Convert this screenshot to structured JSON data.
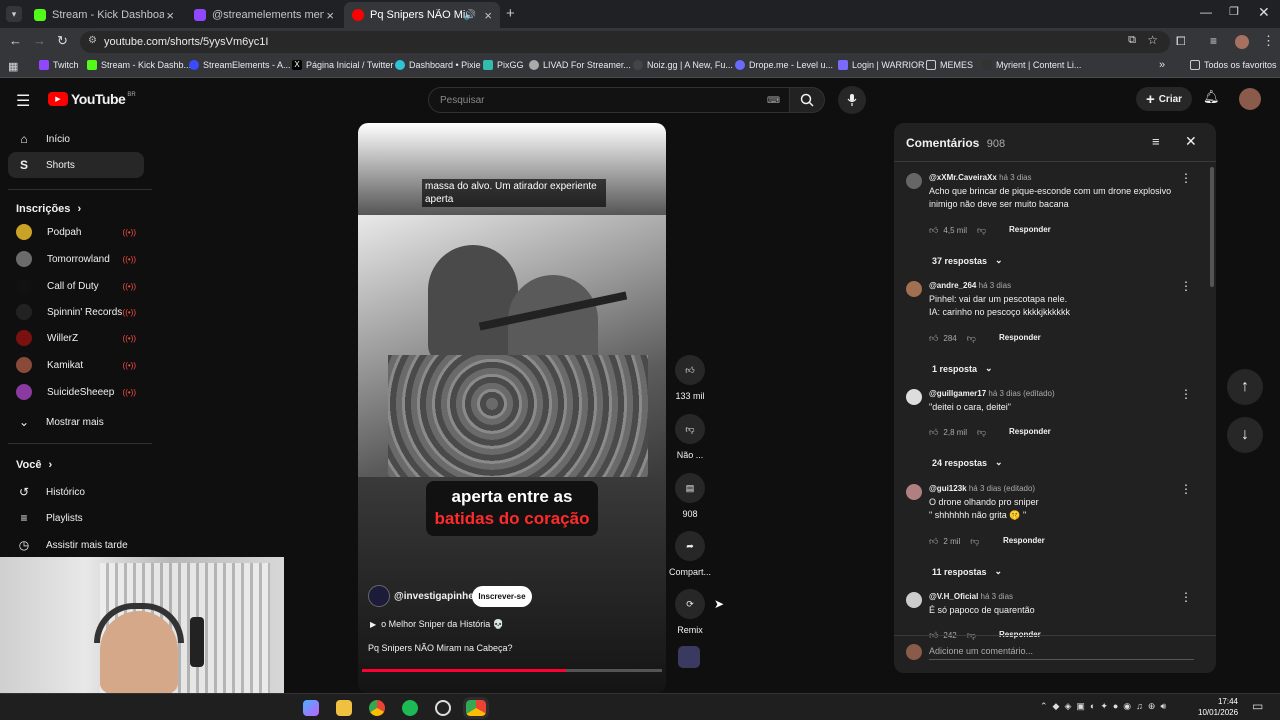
{
  "browser": {
    "tabs": [
      {
        "title": "Stream - Kick Dashboard",
        "color": "#53fc18"
      },
      {
        "title": "@streamelements mentione",
        "color": "#9146ff"
      },
      {
        "title": "Pq Snipers NÃO Miram na C",
        "color": "#ff0000"
      }
    ],
    "url": "youtube.com/shorts/5yysVm6yc1I",
    "bookmarks": [
      "Twitch",
      "Stream - Kick Dashb...",
      "StreamElements - A...",
      "Página Inicial / Twitter",
      "Dashboard • Pixie",
      "PixGG",
      "LIVAD For Streamer...",
      "Noiz.gg | A New, Fu...",
      "Drope.me - Level u...",
      "Login | WARRIOR",
      "MEMES",
      "Myrient | Content Li..."
    ],
    "all_bookmarks": "Todos os favoritos"
  },
  "youtube": {
    "logo_text": "YouTube",
    "country": "BR",
    "search_placeholder": "Pesquisar",
    "create_label": "Criar",
    "sidebar": {
      "home": "Início",
      "shorts": "Shorts",
      "subscriptions_heading": "Inscrições",
      "subscriptions": [
        {
          "name": "Podpah",
          "color": "#c9a227"
        },
        {
          "name": "Tomorrowland",
          "color": "#6b6b6b"
        },
        {
          "name": "Call of Duty",
          "color": "#111111"
        },
        {
          "name": "Spinnin' Records",
          "color": "#222222"
        },
        {
          "name": "WillerZ",
          "color": "#7a1010"
        },
        {
          "name": "Kamikat",
          "color": "#8a4a3a"
        },
        {
          "name": "SuicideSheeep",
          "color": "#8a3aa0"
        }
      ],
      "show_more": "Mostrar mais",
      "you_heading": "Você",
      "history": "Histórico",
      "playlists": "Playlists",
      "watch_later": "Assistir mais tarde"
    },
    "video": {
      "caption": "massa do alvo. Um atirador experiente aperta",
      "overlay_line1": "aperta entre as",
      "overlay_line2": "batidas do coração",
      "channel": "@investigapinhel",
      "subscribe": "Inscrever-se",
      "playlist": "o Melhor Sniper da História 💀",
      "title": "Pq Snipers NÃO Miram na Cabeça?",
      "progress": 0.68
    },
    "actions": {
      "likes": "133 mil",
      "dislike": "Não ...",
      "comments": "908",
      "share": "Compart...",
      "remix": "Remix"
    },
    "comments_panel": {
      "title": "Comentários",
      "count": "908",
      "add_placeholder": "Adicione um comentário...",
      "items": [
        {
          "author": "@xXMr.CaveiraXx",
          "time": "há 3 dias",
          "text": "Acho que brincar de pique-esconde com um drone explosivo inimigo não deve ser muito bacana",
          "likes": "4,5 mil",
          "replies": "37 respostas",
          "avatar": "#666"
        },
        {
          "author": "@andre_264",
          "time": "há 3 dias",
          "text": "Pinhel: vai dar um pescotapa nele.\nIA: carinho no pescoço kkkkjkkkkkk",
          "likes": "284",
          "replies": "1 resposta",
          "avatar": "#a07050"
        },
        {
          "author": "@guillgamer17",
          "time": "há 3 dias (editado)",
          "text": "\"deitei o cara, deitei\"",
          "likes": "2,8 mil",
          "replies": "24 respostas",
          "avatar": "#ddd"
        },
        {
          "author": "@gui123k",
          "time": "há 3 dias (editado)",
          "text": "O drone olhando pro sniper\n\" shhhhhh não grita 🤫 \"",
          "likes": "2 mil",
          "replies": "11 respostas",
          "avatar": "#b08080"
        },
        {
          "author": "@V.H_Oficial",
          "time": "há 3 dias",
          "text": "É só papoco de quarentão",
          "likes": "242",
          "replies": "",
          "avatar": "#ccc"
        }
      ],
      "reply_label": "Responder"
    }
  },
  "taskbar": {
    "time": "17:44",
    "date": "10/01/2026"
  }
}
